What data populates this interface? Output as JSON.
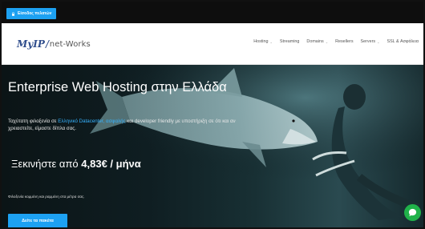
{
  "topbar": {
    "client_area_label": "Είσοδος πελατών"
  },
  "brand": {
    "logo_main": "MyIP",
    "logo_sep": "/",
    "logo_tail": "net-Works"
  },
  "nav": {
    "items": [
      {
        "label": "Hosting",
        "has_dropdown": true
      },
      {
        "label": "Streaming",
        "has_dropdown": false
      },
      {
        "label": "Domains",
        "has_dropdown": true
      },
      {
        "label": "Resellers",
        "has_dropdown": false
      },
      {
        "label": "Servers",
        "has_dropdown": true
      },
      {
        "label": "SSL & Ασφάλεια",
        "has_dropdown": false
      }
    ]
  },
  "hero": {
    "title": "Enterprise Web Hosting στην Ελλάδα",
    "subtitle_part1": "Ταχύτατη φιλοξενία σε ",
    "subtitle_link": "Ελληνικό Datacenter, ασφαλής",
    "subtitle_part2": " και developer friendly με υποστήριξη σε ότι και αν χρειαστείτε, είμαστε δίπλα σας.",
    "price_prefix": "Ξεκινήστε από ",
    "price_value": "4,83€ / μήνα",
    "note": "Φιλοξενία κομμένη και ραμμένη στα μέτρα σας.",
    "cta_label": "Δείτε τα πακέτα"
  },
  "colors": {
    "accent": "#1da1f2",
    "link": "#36b3ff",
    "chat": "#20b24a",
    "logo": "#2f4d8c"
  },
  "icons": {
    "client": "lock-icon",
    "chat": "chat-icon",
    "dropdown": "chevron-down-icon"
  }
}
